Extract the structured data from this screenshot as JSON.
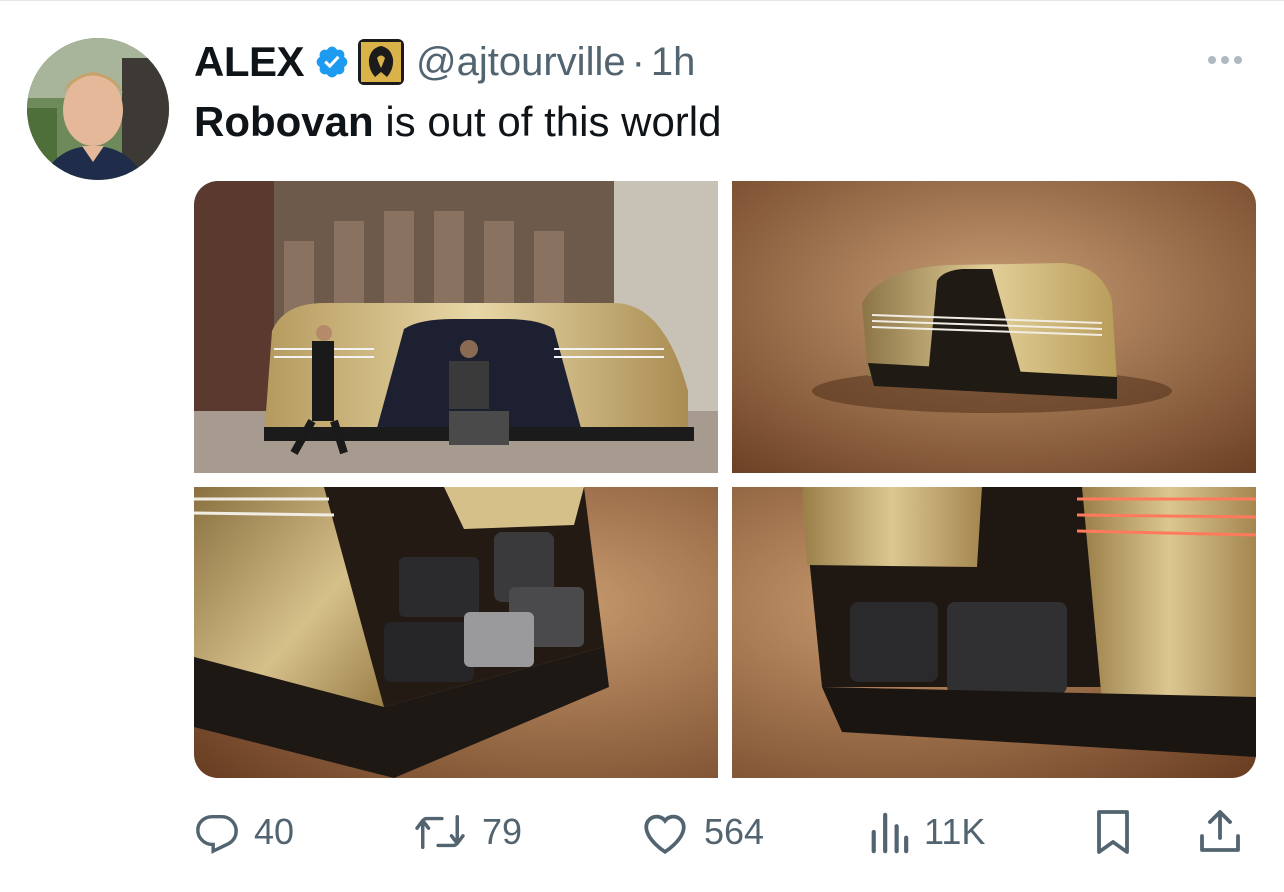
{
  "tweet": {
    "author_name": "ALEX",
    "handle": "@ajtourville",
    "separator": "·",
    "time": "1h",
    "text_bold": "Robovan",
    "text_rest": " is out of this world"
  },
  "media": {
    "count": 4
  },
  "actions": {
    "replies": "40",
    "reposts": "79",
    "likes": "564",
    "views": "11K"
  },
  "colors": {
    "verified": "#1d9bf0",
    "muted_text": "#536471",
    "affiliate_badge": "#1b1b1b",
    "affiliate_mark": "#d9b24a"
  },
  "icons": {
    "reply": "speech-bubble-icon",
    "repost": "repost-arrows-icon",
    "like": "heart-icon",
    "views": "bar-chart-icon",
    "bookmark": "bookmark-icon",
    "share": "share-upload-icon",
    "verified": "verified-badge-icon",
    "more": "more-dots-icon"
  }
}
